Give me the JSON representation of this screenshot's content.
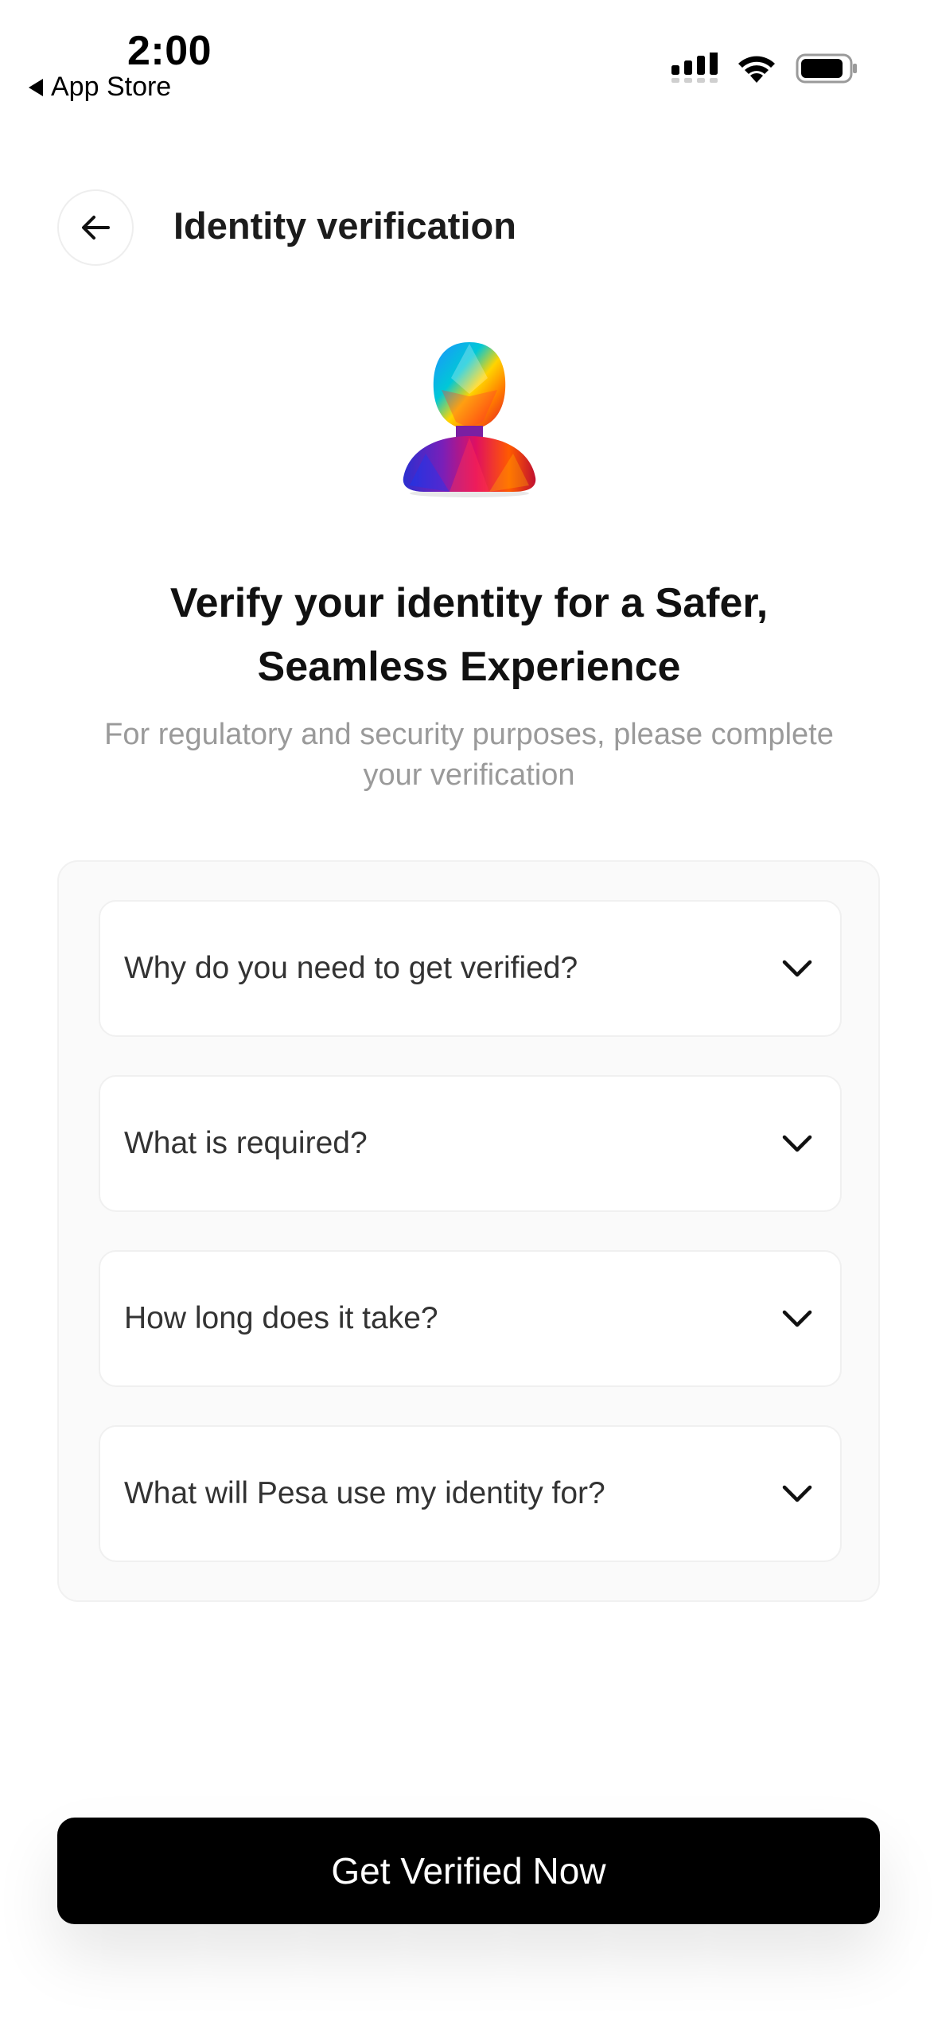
{
  "status_bar": {
    "time": "2:00",
    "back_app_label": "App Store",
    "icons": [
      "signal-icon",
      "wifi-icon",
      "battery-icon"
    ]
  },
  "header": {
    "back_icon": "arrow-left-icon",
    "title": "Identity verification"
  },
  "hero": {
    "illustration": "person-silhouette-icon",
    "headline_line1": "Verify your identity for a Safer,",
    "headline_line2": "Seamless Experience",
    "subtitle": "For regulatory and security purposes, please complete your verification"
  },
  "faq": {
    "items": [
      {
        "question": "Why do you need to get verified?",
        "icon": "chevron-down-icon"
      },
      {
        "question": "What is required?",
        "icon": "chevron-down-icon"
      },
      {
        "question": "How long does it take?",
        "icon": "chevron-down-icon"
      },
      {
        "question": "What will Pesa use my identity for?",
        "icon": "chevron-down-icon"
      }
    ]
  },
  "cta": {
    "label": "Get Verified Now"
  },
  "colors": {
    "background": "#ffffff",
    "cta_background": "#000000",
    "cta_text": "#ffffff",
    "subtitle_text": "#9a9a9a",
    "card_background": "#fafafa"
  }
}
